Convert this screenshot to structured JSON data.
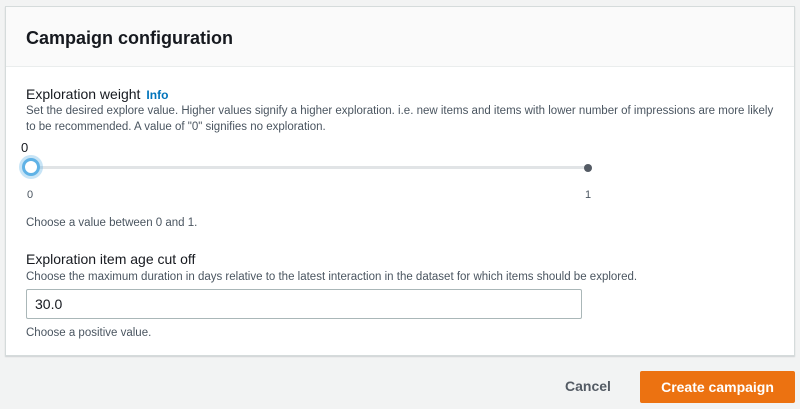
{
  "panel": {
    "title": "Campaign configuration"
  },
  "exploration_weight": {
    "label": "Exploration weight",
    "info_label": "Info",
    "description": "Set the desired explore value. Higher values signify a higher exploration. i.e. new items and items with lower number of impressions are more likely to be recommended. A value of \"0\" signifies no exploration.",
    "current_value": "0",
    "value": 0,
    "min_label": "0",
    "max_label": "1",
    "constraint": "Choose a value between 0 and 1."
  },
  "age_cutoff": {
    "label": "Exploration item age cut off",
    "description": "Choose the maximum duration in days relative to the latest interaction in the dataset for which items should be explored.",
    "value": "30.0",
    "constraint": "Choose a positive value."
  },
  "footer": {
    "cancel_label": "Cancel",
    "submit_label": "Create campaign"
  },
  "colors": {
    "accent": "#0073bb",
    "primary_button": "#ec7211",
    "thumb_ring": "#5fb2e6"
  }
}
